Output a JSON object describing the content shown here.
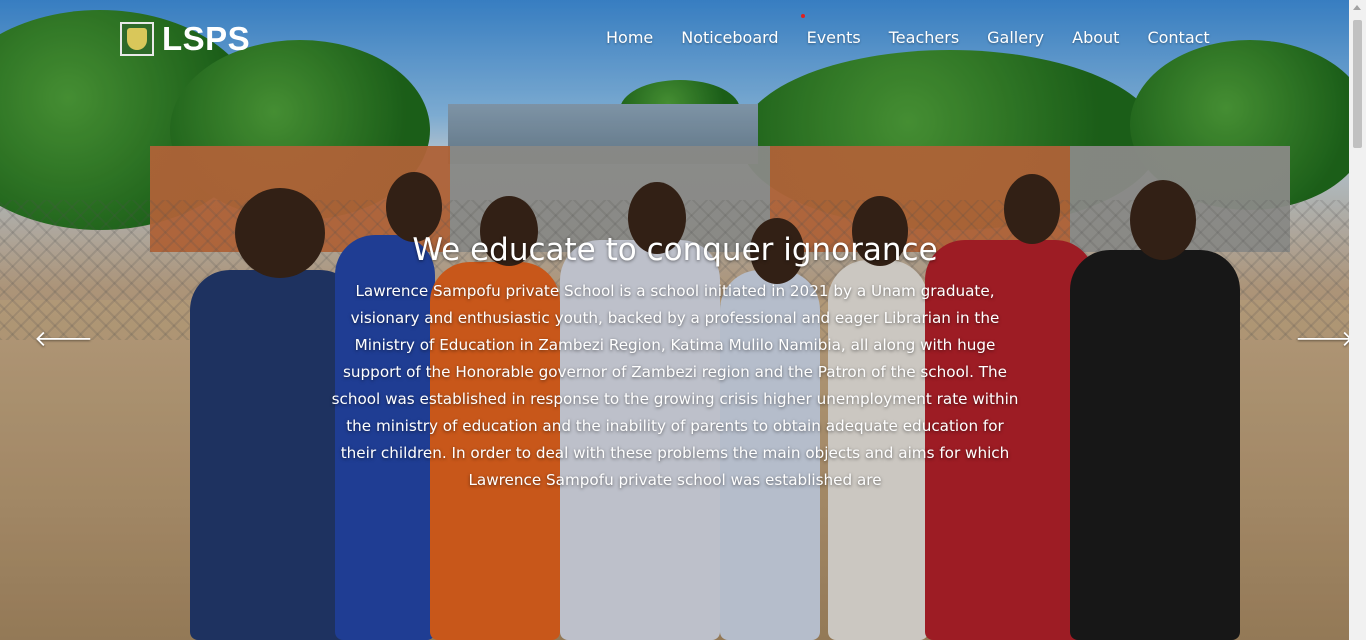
{
  "brand": {
    "name": "LSPS",
    "logo_icon": "school-crest-icon"
  },
  "nav": {
    "items": [
      "Home",
      "Noticeboard",
      "Events",
      "Teachers",
      "Gallery",
      "About",
      "Contact"
    ]
  },
  "hero": {
    "title": "We educate to conquer ignorance",
    "body": "Lawrence Sampofu private School is a school initiated in 2021 by a Unam graduate, visionary and enthusiastic youth, backed by a professional and eager Librarian in the Ministry of Education in Zambezi Region, Katima Mulilo Namibia, all along with huge support of the Honorable governor of Zambezi region and the Patron of the school. The school was established in response to the growing crisis higher unemployment rate within the ministry of education and the inability of parents to obtain adequate education for their children. In order to deal with these problems the main objects and aims for which Lawrence Sampofu private school was established are",
    "prev_icon": "arrow-left-icon",
    "next_icon": "arrow-right-icon",
    "prev_glyph": "🡐",
    "next_glyph": "🡒"
  }
}
